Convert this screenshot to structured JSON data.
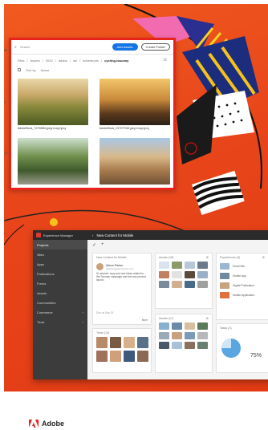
{
  "brand": {
    "name": "Adobe",
    "accent": "#e8231c"
  },
  "assets_window": {
    "search_placeholder": "Search",
    "add_assets_label": "Add Assets",
    "create_folder_label": "Create Folder",
    "breadcrumbs": [
      "Files",
      "Assets",
      "2020",
      "adobe",
      "we",
      "adventures"
    ],
    "breadcrumb_current": "cycling-tuscany",
    "toolbar": {
      "sort": "Sort by",
      "name": "Name"
    },
    "thumbnails": [
      {
        "name": "AdobeStock_74794834.jpeg",
        "meta": "image/jpeg",
        "tone": "hills"
      },
      {
        "name": "AdobeStock_237077045.jpeg",
        "meta": "image/jpeg",
        "tone": "sunset"
      },
      {
        "name": "",
        "meta": "",
        "tone": "riders"
      },
      {
        "name": "",
        "meta": "",
        "tone": "town"
      }
    ]
  },
  "aem_window": {
    "product_name": "Experience Manager",
    "page_title": "New Content for Mobile",
    "sidebar": [
      {
        "label": "Projects",
        "active": true,
        "chevron": false
      },
      {
        "label": "Sites",
        "active": false,
        "chevron": false
      },
      {
        "label": "Apps",
        "active": false,
        "chevron": false
      },
      {
        "label": "Publications",
        "active": false,
        "chevron": false
      },
      {
        "label": "Forms",
        "active": false,
        "chevron": false
      },
      {
        "label": "Assets",
        "active": false,
        "chevron": false
      },
      {
        "label": "Communities",
        "active": false,
        "chevron": false
      },
      {
        "label": "Commerce",
        "active": false,
        "chevron": true
      },
      {
        "label": "Tools",
        "active": false,
        "chevron": true
      }
    ],
    "card_message": {
      "header": "New Content for Mobile",
      "author": "Alison Parker",
      "author_sub": "aparker@geometrixx.com",
      "body": "Hi network, copy and new ideas related to the Summer campaign and the new product launch.",
      "due": "Due on Sep 15",
      "more": "More"
    },
    "card_team_header": "Team (14)",
    "card_assets_header": "Assets (15)",
    "card_assets2_header": "Assets (17)",
    "card_experiences_header": "Experiences (3)",
    "experiences": [
      "Email Site",
      "Mobile App",
      "Digital Publication",
      "Mobile Application"
    ],
    "card_tasks_header": "Tasks (3)",
    "tasks_percent": "75%"
  }
}
